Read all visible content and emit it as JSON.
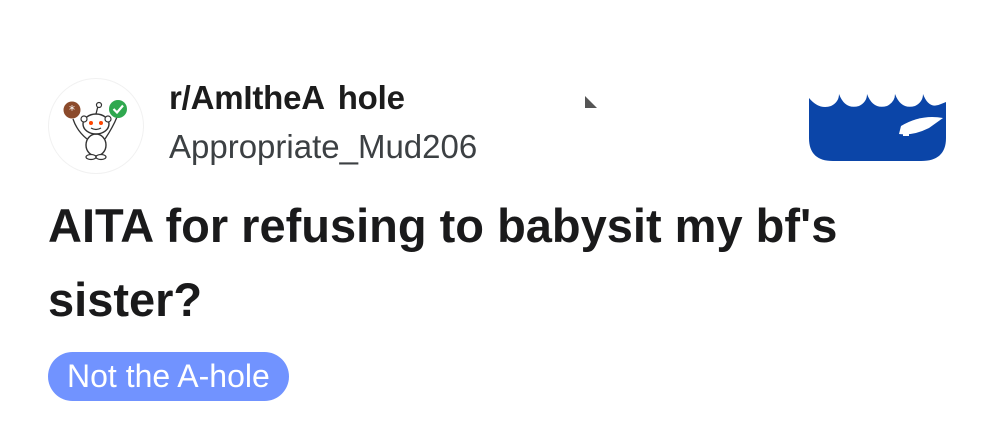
{
  "post": {
    "subreddit": "r/AmItheA  hole",
    "author": "Appropriate_Mud206",
    "title": "AITA for refusing to babysit my bf's sister?",
    "flair": "Not the A-hole"
  },
  "icons": {
    "avatar": "reddit-snoo-avatar-icon",
    "badge": "wave-logo-icon"
  },
  "colors": {
    "flair_bg": "#7193ff",
    "wave_blue": "#0b45a8",
    "title_text": "#1a1a1b"
  }
}
